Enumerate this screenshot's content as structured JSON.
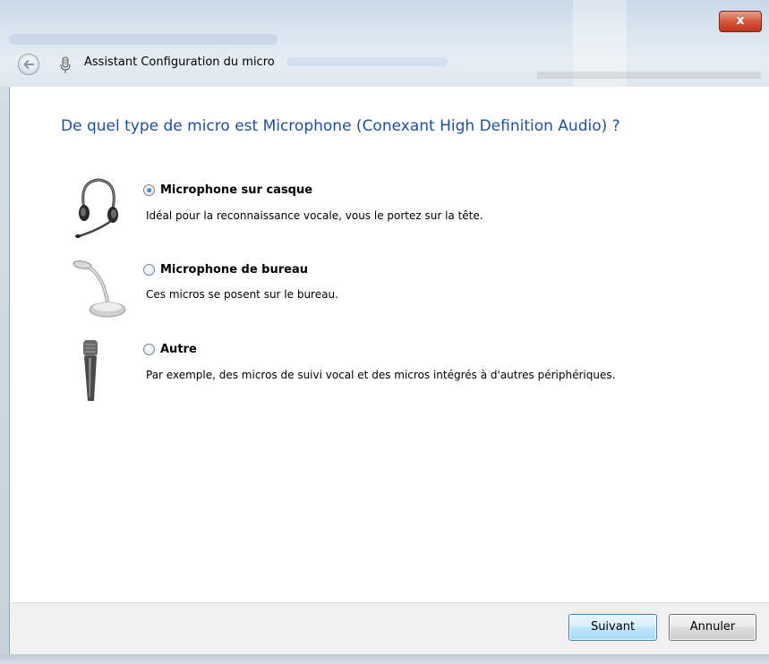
{
  "window": {
    "title": "Assistant Configuration du micro",
    "close_label": "x"
  },
  "page": {
    "question": "De quel type de micro est Microphone (Conexant High Definition Audio) ?"
  },
  "options": [
    {
      "label": "Microphone sur casque",
      "description": "Idéal pour la reconnaissance vocale, vous le portez sur la tête.",
      "icon": "headset-icon",
      "selected": true
    },
    {
      "label": "Microphone de bureau",
      "description": "Ces micros se posent sur le bureau.",
      "icon": "desktop-microphone-icon",
      "selected": false
    },
    {
      "label": "Autre",
      "description": "Par exemple, des micros de suivi vocal et des micros intégrés à d'autres périphériques.",
      "icon": "handheld-microphone-icon",
      "selected": false
    }
  ],
  "footer": {
    "next_label": "Suivant",
    "cancel_label": "Annuler"
  },
  "colors": {
    "question_text": "#1e4fa8",
    "close_button": "#c0341c",
    "default_button_border": "#3c7fb1"
  }
}
